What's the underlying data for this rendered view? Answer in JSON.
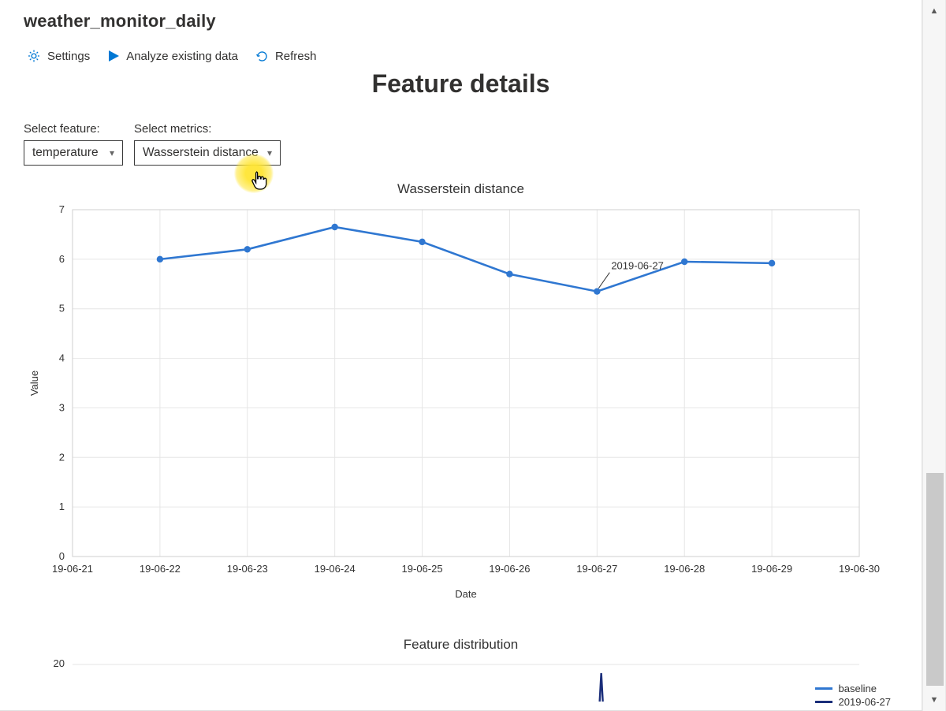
{
  "header": {
    "title": "weather_monitor_daily"
  },
  "toolbar": {
    "settings_label": "Settings",
    "analyze_label": "Analyze existing data",
    "refresh_label": "Refresh"
  },
  "page_title": "Feature details",
  "selectors": {
    "feature_label": "Select feature:",
    "feature_value": "temperature",
    "metrics_label": "Select metrics:",
    "metrics_value": "Wasserstein distance"
  },
  "chart_data": [
    {
      "type": "line",
      "title": "Wasserstein distance",
      "xlabel": "Date",
      "ylabel": "Value",
      "xlim": [
        "19-06-21",
        "19-06-30"
      ],
      "ylim": [
        0,
        7
      ],
      "categories": [
        "19-06-21",
        "19-06-22",
        "19-06-23",
        "19-06-24",
        "19-06-25",
        "19-06-26",
        "19-06-27",
        "19-06-28",
        "19-06-29",
        "19-06-30"
      ],
      "series": [
        {
          "name": "Wasserstein distance",
          "color": "#2f77d1",
          "x": [
            "19-06-22",
            "19-06-23",
            "19-06-24",
            "19-06-25",
            "19-06-26",
            "19-06-27",
            "19-06-28",
            "19-06-29"
          ],
          "values": [
            6.0,
            6.2,
            6.65,
            6.35,
            5.7,
            5.35,
            5.95,
            5.92
          ]
        }
      ],
      "annotation": {
        "text": "2019-06-27",
        "at_x": "19-06-27"
      }
    },
    {
      "type": "line",
      "title": "Feature distribution",
      "ylim": [
        0,
        20
      ],
      "series": [
        {
          "name": "baseline",
          "color": "#2f77d1"
        },
        {
          "name": "2019-06-27",
          "color": "#1b2e7a"
        }
      ]
    }
  ],
  "colors": {
    "accent_blue": "#0078d4",
    "line_blue": "#2f77d1",
    "dark_blue": "#1b2e7a",
    "highlight_yellow": "#ffe533"
  },
  "legend2": {
    "baseline": "baseline",
    "compare": "2019-06-27"
  }
}
